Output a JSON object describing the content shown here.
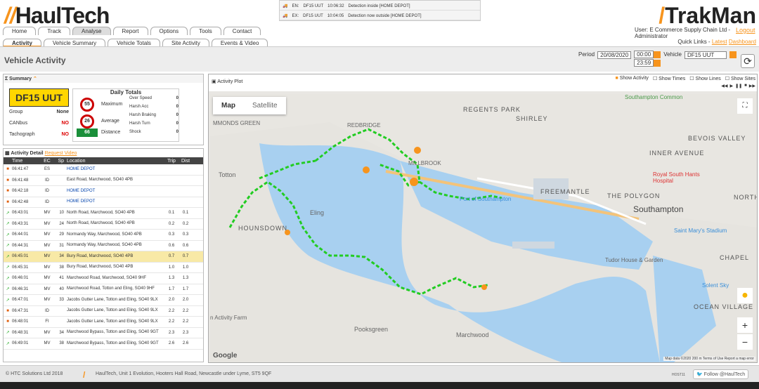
{
  "header": {
    "logo_left": "HaulTech",
    "logo_right": "TrakMan",
    "nav_tabs": [
      "Home",
      "Track",
      "Analyse",
      "Report",
      "Options",
      "Tools",
      "Contact"
    ],
    "sub_tabs": [
      "Activity",
      "Vehicle Summary",
      "Vehicle Totals",
      "Site Activity",
      "Events & Video"
    ],
    "user_label": "User:",
    "user_name": "E Commerce Supply Chain Ltd - Administrator",
    "logout": "Logout",
    "quick_links_label": "Quick Links -",
    "quick_latest": "Latest",
    "quick_dashboard": "Dashboard"
  },
  "notifications": [
    {
      "type": "EN:",
      "plate": "DF15 UUT",
      "time": "10:06:32",
      "msg": "Detection inside [HOME DEPOT]"
    },
    {
      "type": "EX:",
      "plate": "DF15 UUT",
      "time": "10:04:05",
      "msg": "Detection now outside [HOME DEPOT]"
    }
  ],
  "page": {
    "title": "Vehicle Activity",
    "period_label": "Period",
    "period_date": "20/08/2020",
    "time_from": "00:00",
    "time_to": "23:59",
    "vehicle_label": "Vehicle",
    "vehicle_value": "DF15 UUT"
  },
  "summary": {
    "title": "Summary",
    "plate": "DF15 UUT",
    "group_label": "Group",
    "group_value": "None",
    "canbus_label": "CANbus",
    "canbus_value": "NO",
    "tacho_label": "Tachograph",
    "tacho_value": "NO",
    "daily_title": "Daily Totals",
    "max_speed": "55",
    "max_label": "Maximum",
    "avg_speed": "26",
    "avg_label": "Average",
    "distance": "66",
    "distance_label": "Distance",
    "events": [
      {
        "label": "Over Speed",
        "value": "0"
      },
      {
        "label": "Harsh Acc",
        "value": "0"
      },
      {
        "label": "Harsh Braking",
        "value": "0"
      },
      {
        "label": "Harsh Turn",
        "value": "0"
      },
      {
        "label": "Shock",
        "value": "0"
      }
    ]
  },
  "detail": {
    "title": "Activity Detail",
    "request_video": "Request Video",
    "columns": [
      "Time",
      "EC",
      "Sp",
      "Location",
      "Trip",
      "Dist"
    ],
    "rows": [
      {
        "time": "06:41:47",
        "ec": "ES",
        "sp": "",
        "loc": "HOME DEPOT",
        "trip": "",
        "dist": "",
        "link": true
      },
      {
        "time": "06:41:48",
        "ec": "ID",
        "sp": "",
        "loc": "East Road, Marchwood, SO40 4PB",
        "trip": "",
        "dist": ""
      },
      {
        "time": "06:42:18",
        "ec": "ID",
        "sp": "",
        "loc": "HOME DEPOT",
        "trip": "",
        "dist": "",
        "link": true
      },
      {
        "time": "06:42:48",
        "ec": "ID",
        "sp": "",
        "loc": "HOME DEPOT",
        "trip": "",
        "dist": "",
        "link": true
      },
      {
        "time": "06:43:01",
        "ec": "MV",
        "sp": "10",
        "loc": "North Road, Marchwood, SO40 4PB",
        "trip": "0.1",
        "dist": "0.1"
      },
      {
        "time": "06:43:31",
        "ec": "MV",
        "sp": "24",
        "loc": "North Road, Marchwood, SO40 4PB",
        "trip": "0.2",
        "dist": "0.2"
      },
      {
        "time": "06:44:01",
        "ec": "MV",
        "sp": "29",
        "loc": "Normandy Way, Marchwood, SO40 4PB",
        "trip": "0.3",
        "dist": "0.3"
      },
      {
        "time": "06:44:31",
        "ec": "MV",
        "sp": "31",
        "loc": "Normandy Way, Marchwood, SO40 4PB",
        "trip": "0.6",
        "dist": "0.6"
      },
      {
        "time": "06:45:01",
        "ec": "MV",
        "sp": "34",
        "loc": "Bury Road, Marchwood, SO40 4PB",
        "trip": "0.7",
        "dist": "0.7",
        "hl": true
      },
      {
        "time": "06:45:31",
        "ec": "MV",
        "sp": "38",
        "loc": "Bury Road, Marchwood, SO40 4PB",
        "trip": "1.0",
        "dist": "1.0"
      },
      {
        "time": "06:46:01",
        "ec": "MV",
        "sp": "41",
        "loc": "Marchwood Road, Marchwood, SO40 9HF",
        "trip": "1.3",
        "dist": "1.3"
      },
      {
        "time": "06:46:31",
        "ec": "MV",
        "sp": "40",
        "loc": "Marchwood Road, Totton and Eling, SO40 9HF",
        "trip": "1.7",
        "dist": "1.7"
      },
      {
        "time": "06:47:01",
        "ec": "MV",
        "sp": "33",
        "loc": "Jacobs Gutter Lane, Totton and Eling, SO40 9LX",
        "trip": "2.0",
        "dist": "2.0"
      },
      {
        "time": "06:47:31",
        "ec": "ID",
        "sp": "",
        "loc": "Jacobs Gutter Lane, Totton and Eling, SO40 9LX",
        "trip": "2.2",
        "dist": "2.2"
      },
      {
        "time": "06:48:01",
        "ec": "FI",
        "sp": "",
        "loc": "Jacobs Gutter Lane, Totton and Eling, SO40 9LX",
        "trip": "2.2",
        "dist": "2.2"
      },
      {
        "time": "06:48:31",
        "ec": "MV",
        "sp": "34",
        "loc": "Marchwood Bypass, Totton and Eling, SO40 9GT",
        "trip": "2.3",
        "dist": "2.3"
      },
      {
        "time": "06:49:01",
        "ec": "MV",
        "sp": "38",
        "loc": "Marchwood Bypass, Totton and Eling, SO40 9GT",
        "trip": "2.6",
        "dist": "2.6"
      }
    ]
  },
  "map": {
    "title": "Activity Plot",
    "options": [
      "Show Activity",
      "Show Times",
      "Show Lines",
      "Show Sites"
    ],
    "map_btn": "Map",
    "sat_btn": "Satellite",
    "labels": {
      "southampton": "Southampton",
      "redbridge": "REDBRIDGE",
      "millbrook": "MILLBROOK",
      "totton": "Totton",
      "eling": "Eling",
      "hounsdown": "HOUNSDOWN",
      "marchwood": "Marchwood",
      "pooksgreen": "Pooksgreen",
      "freemantle": "FREEMANTLE",
      "polygon": "THE POLYGON",
      "shirley": "SHIRLEY",
      "regents": "REGENTS PARK",
      "bevois": "BEVOIS VALLEY",
      "inner": "INNER AVENUE",
      "northam": "NORTHAM",
      "chapel": "CHAPEL",
      "ocean": "OCEAN VILLAGE",
      "port": "Port of Southampton",
      "royal": "Royal South Hants Hospital",
      "stmarys": "Saint Mary's Stadium",
      "tudor": "Tudor House & Garden",
      "solent": "Solent Sky",
      "farm": "n Activity Farm",
      "common": "Southampton Common",
      "ammonds": "MMONDS GREEN"
    },
    "attribution": "Map data ©2020   200 m   Terms of Use   Report a map error",
    "google": "Google"
  },
  "footer": {
    "copyright": "© HTC Solutions Ltd 2018",
    "address": "HaulTech, Unit 1 Evolution, Hooters Hall Road, Newcastle under Lyme, ST5 9QF",
    "host": "HOST11",
    "follow": "Follow @HaulTech"
  },
  "colors": {
    "accent": "#f7941d",
    "plate": "#ffd600",
    "distance": "#1a8f3a",
    "route": "#22cc22"
  }
}
